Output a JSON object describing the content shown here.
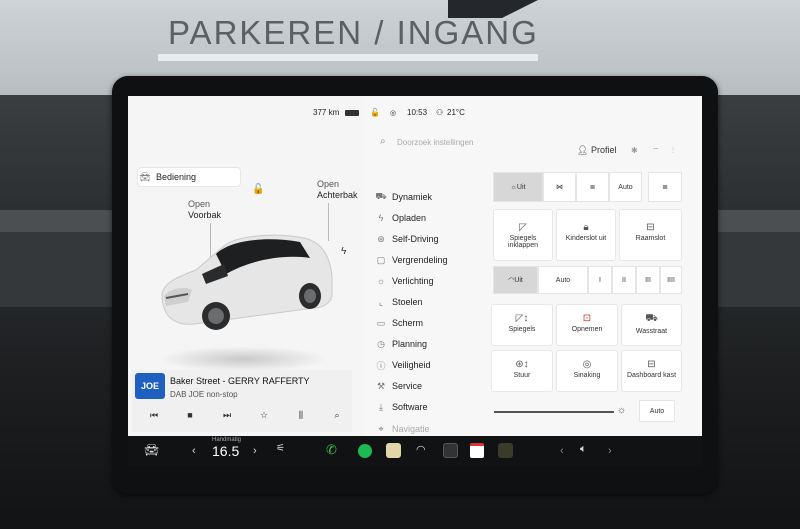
{
  "scene": {
    "sign": "PARKEREN / INGANG"
  },
  "status_bar": {
    "range": "377 km",
    "time": "10:53",
    "temperature": "21°C"
  },
  "car_view": {
    "front_trunk_action": "Open",
    "front_trunk_label": "Voorbak",
    "rear_trunk_action": "Open",
    "rear_trunk_label": "Achterbak"
  },
  "media": {
    "logo_text": "JOE",
    "song": "Baker Street - GERRY RAFFERTY",
    "station": "DAB JOE non-stop"
  },
  "settings": {
    "search_placeholder": "Doorzoek instellingen",
    "profile_label": "Profiel",
    "menu": [
      {
        "label": "Bediening",
        "icon": "car-icon"
      },
      {
        "label": "Dynamiek",
        "icon": "car-icon"
      },
      {
        "label": "Opladen",
        "icon": "bolt-icon"
      },
      {
        "label": "Self-Driving",
        "icon": "steering-icon"
      },
      {
        "label": "Vergrendeling",
        "icon": "lock-icon"
      },
      {
        "label": "Verlichting",
        "icon": "light-icon"
      },
      {
        "label": "Stoelen",
        "icon": "seat-icon"
      },
      {
        "label": "Scherm",
        "icon": "screen-icon"
      },
      {
        "label": "Planning",
        "icon": "clock-icon"
      },
      {
        "label": "Veiligheid",
        "icon": "shield-icon"
      },
      {
        "label": "Service",
        "icon": "wrench-icon"
      },
      {
        "label": "Software",
        "icon": "download-icon"
      },
      {
        "label": "Navigatie",
        "icon": "nav-icon"
      }
    ],
    "lights": {
      "off": "Uit",
      "auto": "Auto"
    },
    "tiles1": [
      "Spiegels inklappen",
      "Kinderslot uit",
      "Raamslot"
    ],
    "wipers": {
      "off": "Uit",
      "auto": "Auto",
      "speeds": [
        "I",
        "II",
        "III",
        "IIII"
      ]
    },
    "tiles2": [
      "Spiegels",
      "Opnemen",
      "Wasstraat"
    ],
    "tiles3": [
      "Stuur",
      "Sinaking",
      "Dashboard kast"
    ],
    "brightness_auto": "Auto"
  },
  "dock": {
    "handmatig": "Handmatig",
    "temp": "16.5"
  }
}
